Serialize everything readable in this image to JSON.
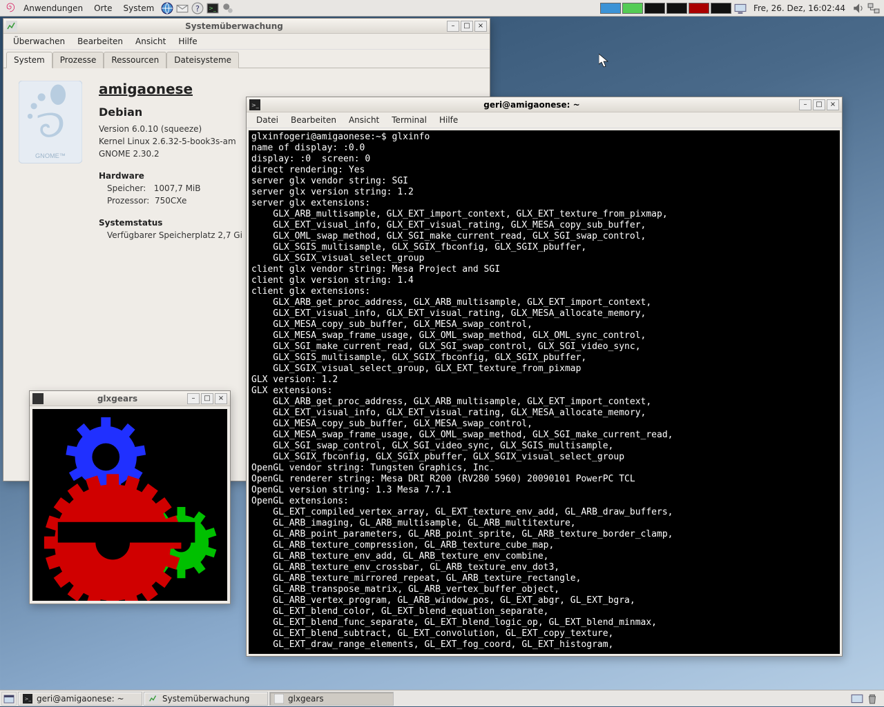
{
  "panel": {
    "anwendungen": "Anwendungen",
    "orte": "Orte",
    "system": "System",
    "clock": "Fre, 26. Dez, 16:02:44"
  },
  "taskbar": {
    "t1": "geri@amigaonese: ~",
    "t2": "Systemüberwachung",
    "t3": "glxgears"
  },
  "sysmon": {
    "title": "Systemüberwachung",
    "menus": {
      "m1": "Überwachen",
      "m2": "Bearbeiten",
      "m3": "Ansicht",
      "m4": "Hilfe"
    },
    "tabs": {
      "t1": "System",
      "t2": "Prozesse",
      "t3": "Ressourcen",
      "t4": "Dateisysteme"
    },
    "host": "amigaonese",
    "distro": "Debian",
    "version": "Version 6.0.10 (squeeze)",
    "kernel": "Kernel Linux 2.6.32-5-book3s-am",
    "gnome": "GNOME 2.30.2",
    "hw_header": "Hardware",
    "mem_label": "Speicher:",
    "mem_value": "1007,7 MiB",
    "cpu_label": "Prozessor:",
    "cpu_value": "750CXe",
    "status_header": "Systemstatus",
    "disk": "Verfügbarer Speicherplatz 2,7 Gi"
  },
  "gears": {
    "title": "glxgears"
  },
  "term": {
    "title": "geri@amigaonese: ~",
    "menus": {
      "m1": "Datei",
      "m2": "Bearbeiten",
      "m3": "Ansicht",
      "m4": "Terminal",
      "m5": "Hilfe"
    },
    "lines": [
      "glxinfogeri@amigaonese:~$ glxinfo",
      "name of display: :0.0",
      "display: :0  screen: 0",
      "direct rendering: Yes",
      "server glx vendor string: SGI",
      "server glx version string: 1.2",
      "server glx extensions:",
      "    GLX_ARB_multisample, GLX_EXT_import_context, GLX_EXT_texture_from_pixmap,",
      "    GLX_EXT_visual_info, GLX_EXT_visual_rating, GLX_MESA_copy_sub_buffer,",
      "    GLX_OML_swap_method, GLX_SGI_make_current_read, GLX_SGI_swap_control,",
      "    GLX_SGIS_multisample, GLX_SGIX_fbconfig, GLX_SGIX_pbuffer,",
      "    GLX_SGIX_visual_select_group",
      "client glx vendor string: Mesa Project and SGI",
      "client glx version string: 1.4",
      "client glx extensions:",
      "    GLX_ARB_get_proc_address, GLX_ARB_multisample, GLX_EXT_import_context,",
      "    GLX_EXT_visual_info, GLX_EXT_visual_rating, GLX_MESA_allocate_memory,",
      "    GLX_MESA_copy_sub_buffer, GLX_MESA_swap_control,",
      "    GLX_MESA_swap_frame_usage, GLX_OML_swap_method, GLX_OML_sync_control,",
      "    GLX_SGI_make_current_read, GLX_SGI_swap_control, GLX_SGI_video_sync,",
      "    GLX_SGIS_multisample, GLX_SGIX_fbconfig, GLX_SGIX_pbuffer,",
      "    GLX_SGIX_visual_select_group, GLX_EXT_texture_from_pixmap",
      "GLX version: 1.2",
      "GLX extensions:",
      "    GLX_ARB_get_proc_address, GLX_ARB_multisample, GLX_EXT_import_context,",
      "    GLX_EXT_visual_info, GLX_EXT_visual_rating, GLX_MESA_allocate_memory,",
      "    GLX_MESA_copy_sub_buffer, GLX_MESA_swap_control,",
      "    GLX_MESA_swap_frame_usage, GLX_OML_swap_method, GLX_SGI_make_current_read,",
      "    GLX_SGI_swap_control, GLX_SGI_video_sync, GLX_SGIS_multisample,",
      "    GLX_SGIX_fbconfig, GLX_SGIX_pbuffer, GLX_SGIX_visual_select_group",
      "OpenGL vendor string: Tungsten Graphics, Inc.",
      "OpenGL renderer string: Mesa DRI R200 (RV280 5960) 20090101 PowerPC TCL",
      "OpenGL version string: 1.3 Mesa 7.7.1",
      "OpenGL extensions:",
      "    GL_EXT_compiled_vertex_array, GL_EXT_texture_env_add, GL_ARB_draw_buffers,",
      "    GL_ARB_imaging, GL_ARB_multisample, GL_ARB_multitexture,",
      "    GL_ARB_point_parameters, GL_ARB_point_sprite, GL_ARB_texture_border_clamp,",
      "    GL_ARB_texture_compression, GL_ARB_texture_cube_map,",
      "    GL_ARB_texture_env_add, GL_ARB_texture_env_combine,",
      "    GL_ARB_texture_env_crossbar, GL_ARB_texture_env_dot3,",
      "    GL_ARB_texture_mirrored_repeat, GL_ARB_texture_rectangle,",
      "    GL_ARB_transpose_matrix, GL_ARB_vertex_buffer_object,",
      "    GL_ARB_vertex_program, GL_ARB_window_pos, GL_EXT_abgr, GL_EXT_bgra,",
      "    GL_EXT_blend_color, GL_EXT_blend_equation_separate,",
      "    GL_EXT_blend_func_separate, GL_EXT_blend_logic_op, GL_EXT_blend_minmax,",
      "    GL_EXT_blend_subtract, GL_EXT_convolution, GL_EXT_copy_texture,",
      "    GL_EXT_draw_range_elements, GL_EXT_fog_coord, GL_EXT_histogram,"
    ]
  }
}
